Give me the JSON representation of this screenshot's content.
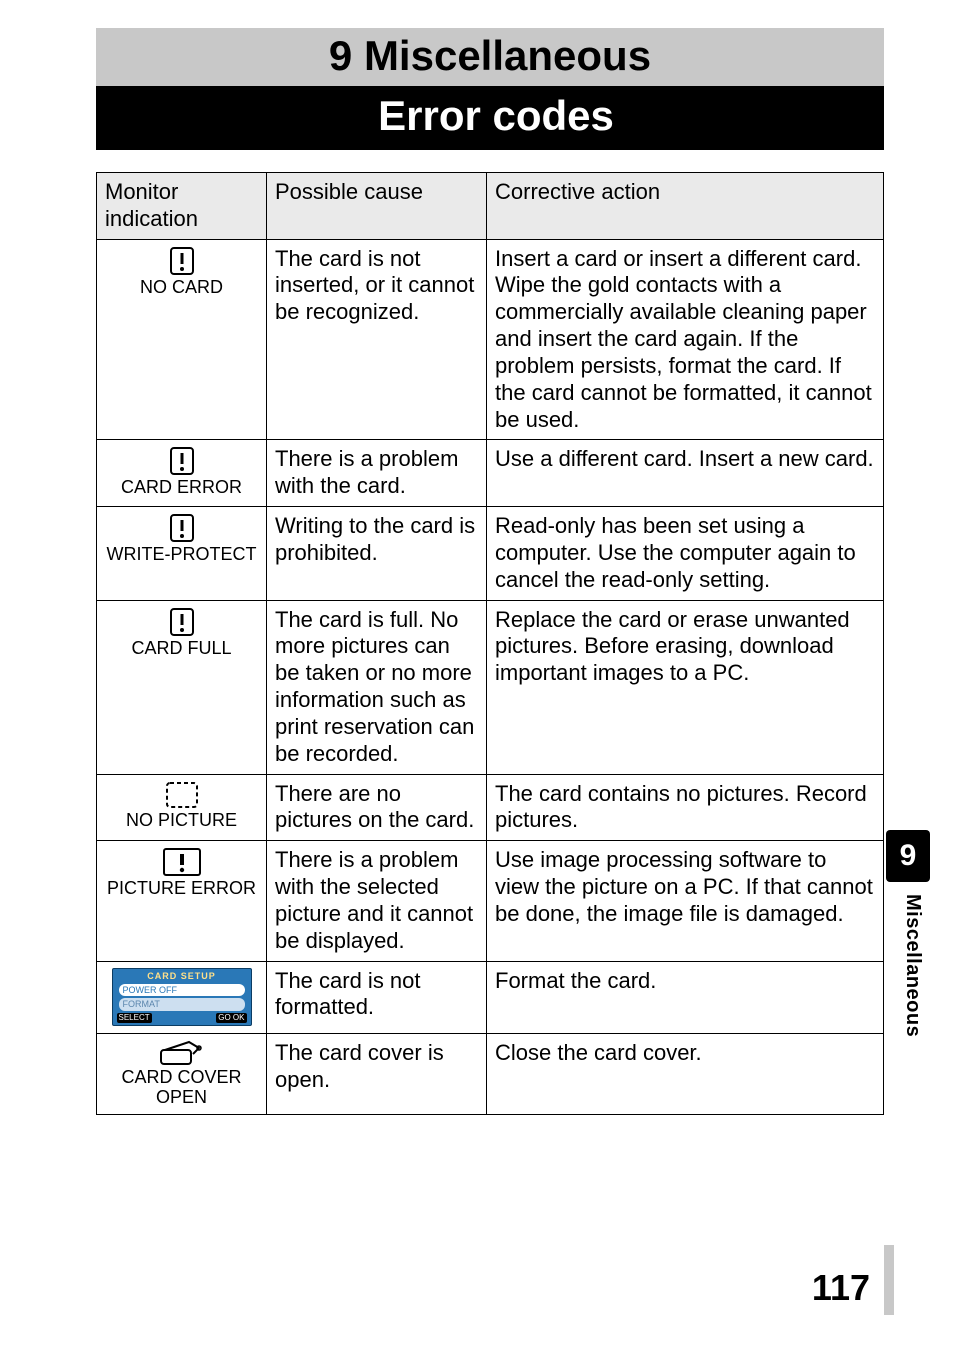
{
  "chapter": {
    "title": "9 Miscellaneous"
  },
  "section": {
    "title": "Error codes"
  },
  "table": {
    "headers": {
      "monitor": "Monitor indication",
      "cause": "Possible cause",
      "action": "Corrective action"
    },
    "rows": [
      {
        "icon": "warn-box",
        "monitor": "NO CARD",
        "cause": "The card is not inserted, or it cannot be recognized.",
        "action": "Insert a card or insert a different card.\nWipe the gold contacts with a commercially available cleaning paper and insert the card again. If the problem persists, format the card. If the card cannot be formatted, it cannot be used."
      },
      {
        "icon": "warn-box",
        "monitor": "CARD ERROR",
        "cause": "There is a problem with the card.",
        "action": "Use a different card.\nInsert a new card."
      },
      {
        "icon": "warn-box",
        "monitor": "WRITE-PROTECT",
        "cause": "Writing to the card is prohibited.",
        "action": "Read-only has been set using a computer. Use the computer again to cancel the read-only setting."
      },
      {
        "icon": "warn-box",
        "monitor": "CARD FULL",
        "cause": "The card is full. No more pictures can be taken or no more information such as print reservation can be recorded.",
        "action": "Replace the card or erase unwanted pictures. Before erasing, download important images to a PC."
      },
      {
        "icon": "dashed-box",
        "monitor": "NO PICTURE",
        "cause": "There are no pictures on the card.",
        "action": "The card contains no pictures. Record pictures."
      },
      {
        "icon": "warn-solid",
        "monitor": "PICTURE ERROR",
        "cause": "There is a problem with the selected picture and it cannot be displayed.",
        "action": "Use image processing software to view the picture on a PC. If that cannot be done, the image file is damaged."
      },
      {
        "icon": "card-setup",
        "monitor": "",
        "cause": "The card is not formatted.",
        "action": "Format the card."
      },
      {
        "icon": "card-cover",
        "monitor": "CARD COVER OPEN",
        "cause": "The card cover is open.",
        "action": "Close the card cover."
      }
    ]
  },
  "card_setup_menu": {
    "header": "CARD SETUP",
    "row1": "POWER OFF",
    "row2": "FORMAT",
    "footer_left": "SELECT",
    "footer_right": "GO  OK"
  },
  "side": {
    "tab": "9",
    "label": "Miscellaneous"
  },
  "page_number": "117"
}
